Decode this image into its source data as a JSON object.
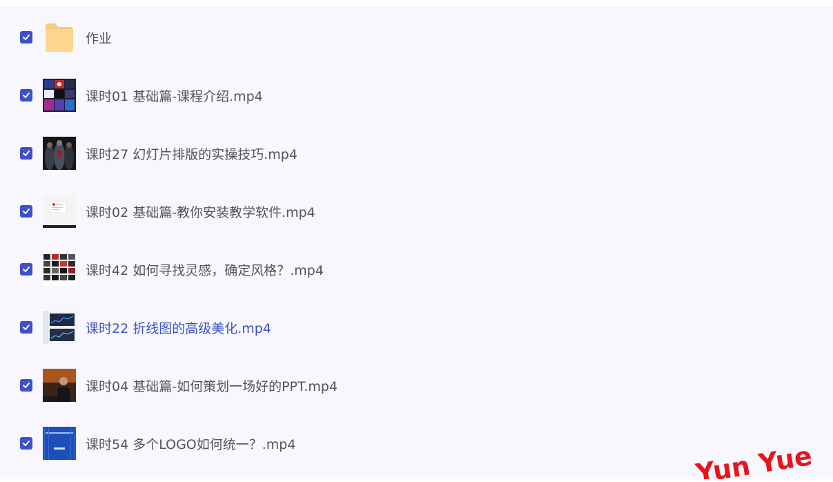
{
  "files": [
    {
      "name": "作业",
      "type": "folder",
      "checked": true,
      "active": false,
      "icon": "folder-icon"
    },
    {
      "name": "课时01 基础篇-课程介绍.mp4",
      "type": "video",
      "checked": true,
      "active": false,
      "icon": "video-thumbnail"
    },
    {
      "name": "课时27 幻灯片排版的实操技巧.mp4",
      "type": "video",
      "checked": true,
      "active": false,
      "icon": "video-thumbnail"
    },
    {
      "name": "课时02 基础篇-教你安装教学软件.mp4",
      "type": "video",
      "checked": true,
      "active": false,
      "icon": "video-thumbnail"
    },
    {
      "name": "课时42 如何寻找灵感，确定风格？.mp4",
      "type": "video",
      "checked": true,
      "active": false,
      "icon": "video-thumbnail"
    },
    {
      "name": "课时22 折线图的高级美化.mp4",
      "type": "video",
      "checked": true,
      "active": true,
      "icon": "video-thumbnail"
    },
    {
      "name": "课时04 基础篇-如何策划一场好的PPT.mp4",
      "type": "video",
      "checked": true,
      "active": false,
      "icon": "video-thumbnail"
    },
    {
      "name": "课时54 多个LOGO如何统一？.mp4",
      "type": "video",
      "checked": true,
      "active": false,
      "icon": "video-thumbnail"
    }
  ],
  "watermark": {
    "text": "Yun Yue",
    "color": "#e8141c"
  },
  "colors": {
    "checkbox": "#3f4fcc",
    "active_text": "#3d51c4",
    "text": "#555555",
    "list_bg": "#f7f7fd"
  }
}
